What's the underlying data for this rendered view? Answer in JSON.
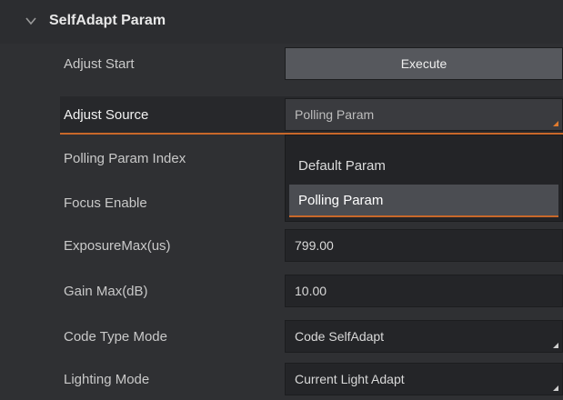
{
  "section": {
    "title": "SelfAdapt Param",
    "icon": "chevron-down-icon"
  },
  "rows": [
    {
      "label": "Adjust Start",
      "value": "Execute",
      "kind": "button"
    },
    {
      "label": "Adjust Source",
      "value": "Polling Param",
      "kind": "select"
    },
    {
      "label": "Polling Param Index",
      "value": "",
      "kind": "hidden"
    },
    {
      "label": "Focus Enable",
      "value": "",
      "kind": "hidden"
    },
    {
      "label": "ExposureMax(us)",
      "value": "799.00",
      "kind": "number"
    },
    {
      "label": "Gain Max(dB)",
      "value": "10.00",
      "kind": "number"
    },
    {
      "label": "Code Type Mode",
      "value": "Code SelfAdapt",
      "kind": "select"
    },
    {
      "label": "Lighting Mode",
      "value": "Current Light Adapt",
      "kind": "select"
    }
  ],
  "dropdown": {
    "options": [
      "Default Param",
      "Polling Param"
    ],
    "selected": "Polling Param"
  },
  "colors": {
    "accent": "#c8682a",
    "panel_bg": "#2f3033",
    "field_bg": "#242528"
  }
}
